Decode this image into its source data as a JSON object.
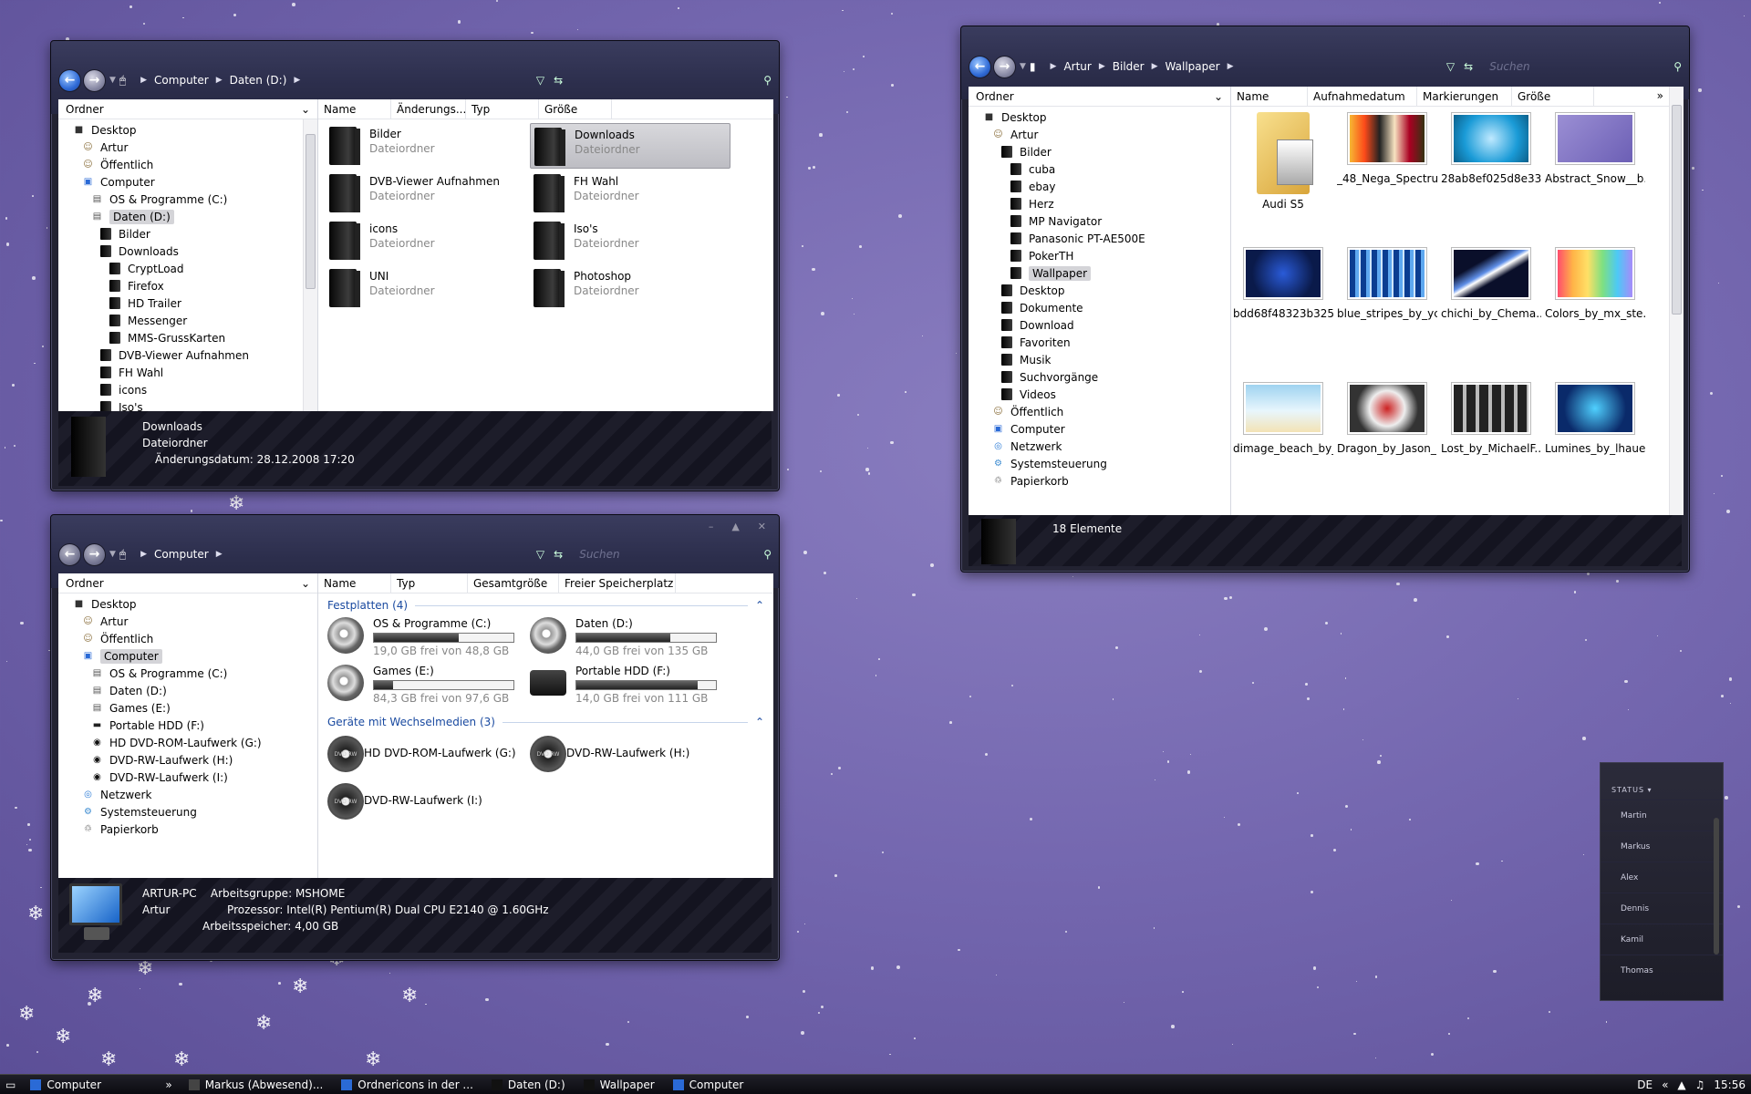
{
  "window1": {
    "breadcrumb": [
      "Computer",
      "Daten (D:)"
    ],
    "tree_header": "Ordner",
    "tree": [
      {
        "label": "Desktop",
        "indent": 0,
        "icon": "desktop"
      },
      {
        "label": "Artur",
        "indent": 1,
        "icon": "user"
      },
      {
        "label": "Öffentlich",
        "indent": 1,
        "icon": "user"
      },
      {
        "label": "Computer",
        "indent": 1,
        "icon": "computer"
      },
      {
        "label": "OS & Programme (C:)",
        "indent": 2,
        "icon": "drive"
      },
      {
        "label": "Daten (D:)",
        "indent": 2,
        "icon": "drive",
        "selected": true
      },
      {
        "label": "Bilder",
        "indent": 3,
        "icon": "folder"
      },
      {
        "label": "Downloads",
        "indent": 3,
        "icon": "folder"
      },
      {
        "label": "CryptLoad",
        "indent": 4,
        "icon": "folder"
      },
      {
        "label": "Firefox",
        "indent": 4,
        "icon": "folder"
      },
      {
        "label": "HD Trailer",
        "indent": 4,
        "icon": "folder"
      },
      {
        "label": "Messenger",
        "indent": 4,
        "icon": "folder"
      },
      {
        "label": "MMS-GrussKarten",
        "indent": 4,
        "icon": "folder"
      },
      {
        "label": "DVB-Viewer Aufnahmen",
        "indent": 3,
        "icon": "folder"
      },
      {
        "label": "FH Wahl",
        "indent": 3,
        "icon": "folder"
      },
      {
        "label": "icons",
        "indent": 3,
        "icon": "folder"
      },
      {
        "label": "Iso's",
        "indent": 3,
        "icon": "folder"
      }
    ],
    "columns": [
      "Name",
      "Änderungs...",
      "Typ",
      "Größe"
    ],
    "items": [
      {
        "name": "Bilder",
        "type": "Dateiordner"
      },
      {
        "name": "Downloads",
        "type": "Dateiordner",
        "selected": true
      },
      {
        "name": "DVB-Viewer Aufnahmen",
        "type": "Dateiordner"
      },
      {
        "name": "FH Wahl",
        "type": "Dateiordner"
      },
      {
        "name": "icons",
        "type": "Dateiordner"
      },
      {
        "name": "Iso's",
        "type": "Dateiordner"
      },
      {
        "name": "UNI",
        "type": "Dateiordner"
      },
      {
        "name": "Photoshop",
        "type": "Dateiordner"
      }
    ],
    "details": {
      "name": "Downloads",
      "type": "Dateiordner",
      "date_label": "Änderungsdatum:",
      "date": "28.12.2008 17:20"
    }
  },
  "window2": {
    "breadcrumb": [
      "Computer"
    ],
    "search_placeholder": "Suchen",
    "tree_header": "Ordner",
    "tree": [
      {
        "label": "Desktop",
        "indent": 0,
        "icon": "desktop"
      },
      {
        "label": "Artur",
        "indent": 1,
        "icon": "user"
      },
      {
        "label": "Öffentlich",
        "indent": 1,
        "icon": "user"
      },
      {
        "label": "Computer",
        "indent": 1,
        "icon": "computer",
        "selected": true
      },
      {
        "label": "OS & Programme (C:)",
        "indent": 2,
        "icon": "drive"
      },
      {
        "label": "Daten (D:)",
        "indent": 2,
        "icon": "drive"
      },
      {
        "label": "Games (E:)",
        "indent": 2,
        "icon": "drive"
      },
      {
        "label": "Portable HDD (F:)",
        "indent": 2,
        "icon": "hdd"
      },
      {
        "label": "HD DVD-ROM-Laufwerk (G:)",
        "indent": 2,
        "icon": "disc"
      },
      {
        "label": "DVD-RW-Laufwerk (H:)",
        "indent": 2,
        "icon": "disc"
      },
      {
        "label": "DVD-RW-Laufwerk (I:)",
        "indent": 2,
        "icon": "disc"
      },
      {
        "label": "Netzwerk",
        "indent": 1,
        "icon": "network"
      },
      {
        "label": "Systemsteuerung",
        "indent": 1,
        "icon": "control"
      },
      {
        "label": "Papierkorb",
        "indent": 1,
        "icon": "trash"
      }
    ],
    "columns": [
      "Name",
      "Typ",
      "Gesamtgröße",
      "Freier Speicherplatz"
    ],
    "group1": "Festplatten (4)",
    "drives": [
      {
        "name": "OS & Programme (C:)",
        "free": "19,0 GB frei von 48,8 GB",
        "used": 0.61
      },
      {
        "name": "Daten (D:)",
        "free": "44,0 GB frei von 135 GB",
        "used": 0.67
      },
      {
        "name": "Games (E:)",
        "free": "84,3 GB frei von 97,6 GB",
        "used": 0.14
      },
      {
        "name": "Portable HDD (F:)",
        "free": "14,0 GB frei von 111 GB",
        "used": 0.87
      }
    ],
    "group2": "Geräte mit Wechselmedien (3)",
    "removable": [
      "HD DVD-ROM-Laufwerk (G:)",
      "DVD-RW-Laufwerk (H:)",
      "DVD-RW-Laufwerk (I:)"
    ],
    "details": {
      "pc": "ARTUR-PC",
      "workgroup_label": "Arbeitsgruppe:",
      "workgroup": "MSHOME",
      "user": "Artur",
      "cpu_label": "Prozessor:",
      "cpu": "Intel(R) Pentium(R) Dual  CPU  E2140  @ 1.60GHz",
      "ram_label": "Arbeitsspeicher:",
      "ram": "4,00 GB"
    }
  },
  "window3": {
    "breadcrumb": [
      "Artur",
      "Bilder",
      "Wallpaper"
    ],
    "search_placeholder": "Suchen",
    "tree_header": "Ordner",
    "tree": [
      {
        "label": "Desktop",
        "indent": 0,
        "icon": "desktop"
      },
      {
        "label": "Artur",
        "indent": 1,
        "icon": "user"
      },
      {
        "label": "Bilder",
        "indent": 2,
        "icon": "folder"
      },
      {
        "label": "cuba",
        "indent": 3,
        "icon": "folder"
      },
      {
        "label": "ebay",
        "indent": 3,
        "icon": "folder"
      },
      {
        "label": "Herz",
        "indent": 3,
        "icon": "folder"
      },
      {
        "label": "MP Navigator",
        "indent": 3,
        "icon": "folder"
      },
      {
        "label": "Panasonic PT-AE500E",
        "indent": 3,
        "icon": "folder"
      },
      {
        "label": "PokerTH",
        "indent": 3,
        "icon": "folder"
      },
      {
        "label": "Wallpaper",
        "indent": 3,
        "icon": "folder",
        "selected": true
      },
      {
        "label": "Desktop",
        "indent": 2,
        "icon": "folder"
      },
      {
        "label": "Dokumente",
        "indent": 2,
        "icon": "folder"
      },
      {
        "label": "Download",
        "indent": 2,
        "icon": "folder"
      },
      {
        "label": "Favoriten",
        "indent": 2,
        "icon": "folder"
      },
      {
        "label": "Musik",
        "indent": 2,
        "icon": "folder"
      },
      {
        "label": "Suchvorgänge",
        "indent": 2,
        "icon": "folder"
      },
      {
        "label": "Videos",
        "indent": 2,
        "icon": "folder"
      },
      {
        "label": "Öffentlich",
        "indent": 1,
        "icon": "user"
      },
      {
        "label": "Computer",
        "indent": 1,
        "icon": "computer"
      },
      {
        "label": "Netzwerk",
        "indent": 1,
        "icon": "network"
      },
      {
        "label": "Systemsteuerung",
        "indent": 1,
        "icon": "control"
      },
      {
        "label": "Papierkorb",
        "indent": 1,
        "icon": "trash"
      }
    ],
    "columns": [
      "Name",
      "Aufnahmedatum",
      "Markierungen",
      "Größe"
    ],
    "thumbs": [
      {
        "label": "Audi S5",
        "kind": "folder"
      },
      {
        "label": "_48_Nega_Spectru...",
        "color": "linear-gradient(90deg,#f7b733,#fc4a1a,#222,#f7e3c1,#a02,#331)"
      },
      {
        "label": "28ab8ef025d8e33f...",
        "color": "radial-gradient(circle,#bfe9ff,#1a9bd7 60%,#0b5f8a)"
      },
      {
        "label": "Abstract_Snow__b...",
        "color": "linear-gradient(135deg,#9b8fd4,#6c5fb5)"
      },
      {
        "label": "bdd68f48323b325...",
        "color": "radial-gradient(circle,#2a5bd8,#0a1a4a 70%)"
      },
      {
        "label": "blue_stripes_by_yc...",
        "color": "repeating-linear-gradient(90deg,#0b3d91 0 6px,#5ea8f0 6px 10px,#cfe6ff 10px 12px)"
      },
      {
        "label": "chichi_by_Chema...",
        "color": "linear-gradient(150deg,#0a0f2a 30%,#5f8fe8 45%,#fff 50%,#0a0f2a 60%)"
      },
      {
        "label": "Colors_by_mx_ste...",
        "color": "linear-gradient(90deg,#ff4d6d,#ffb347,#ffe066,#7ee081,#4dc9f6,#a78bfa)"
      },
      {
        "label": "dimage_beach_by_...",
        "color": "linear-gradient(#9fd3f0,#e8f6fd 55%,#f3e3b5)"
      },
      {
        "label": "Dragon_by_Jason_...",
        "color": "radial-gradient(circle,#c22,#eee 40%,#333 70%)"
      },
      {
        "label": "Lost_by_MichaelF...",
        "color": "repeating-linear-gradient(90deg,#222 0 10px,#bbb 10px 14px)"
      },
      {
        "label": "Lumines_by_lhaue...",
        "color": "radial-gradient(circle,#4fd0ff,#0a2a6a 70%)"
      }
    ],
    "status": "18 Elemente"
  },
  "gadget": {
    "header": "STATUS",
    "contacts": [
      "Martin",
      "Markus",
      "Alex",
      "Dennis",
      "Kamil",
      "Thomas"
    ]
  },
  "taskbar": {
    "items": [
      "Computer",
      "Markus (Abwesend)...",
      "Ordnericons in der ...",
      "Daten (D:)",
      "Wallpaper",
      "Computer"
    ],
    "lang": "DE",
    "clock": "15:56"
  }
}
